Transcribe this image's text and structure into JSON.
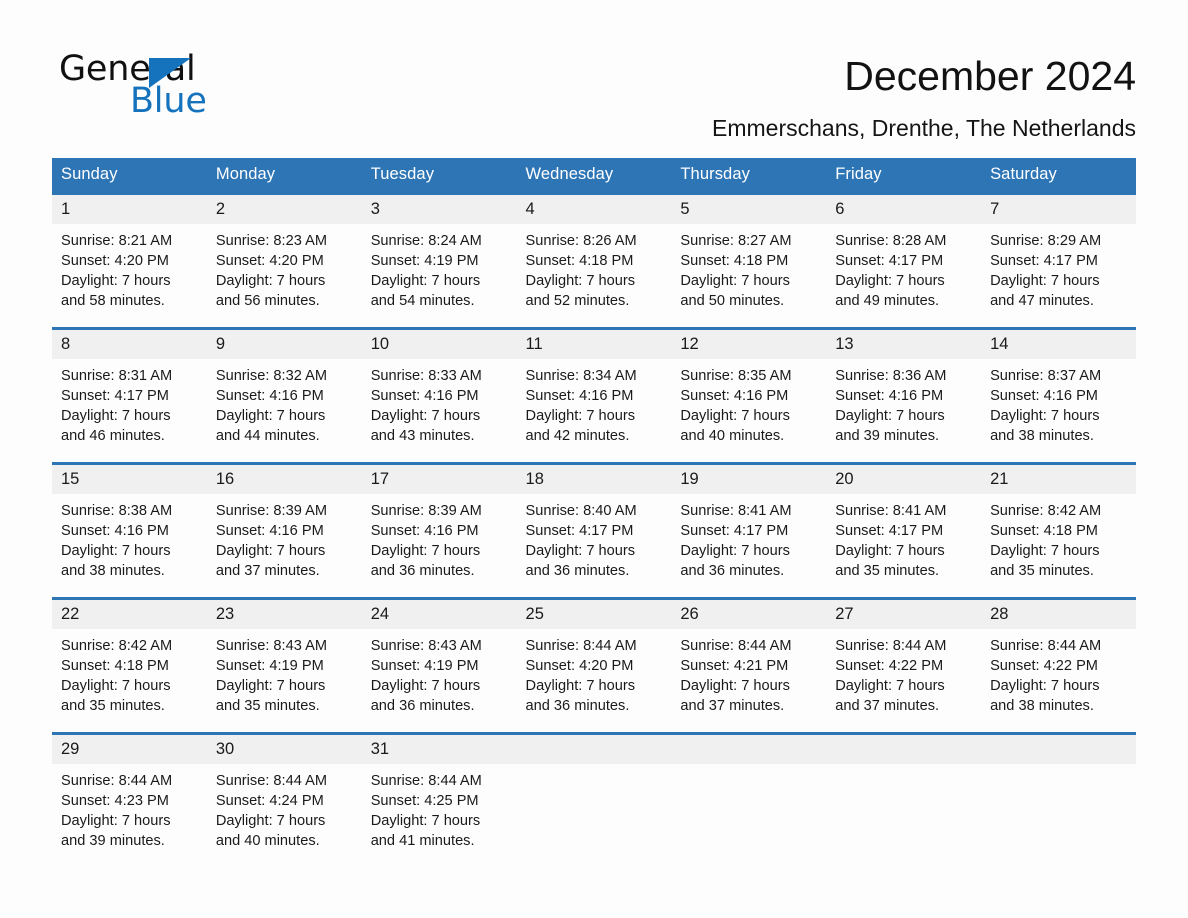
{
  "brand": {
    "name_part1": "General",
    "name_part2": "Blue",
    "accent_color": "#1573bd"
  },
  "header": {
    "title": "December 2024",
    "subtitle": "Emmerschans, Drenthe, The Netherlands",
    "header_band_color": "#2e75b6",
    "day_band_color": "#f0f0f0"
  },
  "calendar": {
    "weekday_headers": [
      "Sunday",
      "Monday",
      "Tuesday",
      "Wednesday",
      "Thursday",
      "Friday",
      "Saturday"
    ],
    "weeks": [
      [
        {
          "day": "1",
          "sunrise": "Sunrise: 8:21 AM",
          "sunset": "Sunset: 4:20 PM",
          "daylight_line1": "Daylight: 7 hours",
          "daylight_line2": "and 58 minutes."
        },
        {
          "day": "2",
          "sunrise": "Sunrise: 8:23 AM",
          "sunset": "Sunset: 4:20 PM",
          "daylight_line1": "Daylight: 7 hours",
          "daylight_line2": "and 56 minutes."
        },
        {
          "day": "3",
          "sunrise": "Sunrise: 8:24 AM",
          "sunset": "Sunset: 4:19 PM",
          "daylight_line1": "Daylight: 7 hours",
          "daylight_line2": "and 54 minutes."
        },
        {
          "day": "4",
          "sunrise": "Sunrise: 8:26 AM",
          "sunset": "Sunset: 4:18 PM",
          "daylight_line1": "Daylight: 7 hours",
          "daylight_line2": "and 52 minutes."
        },
        {
          "day": "5",
          "sunrise": "Sunrise: 8:27 AM",
          "sunset": "Sunset: 4:18 PM",
          "daylight_line1": "Daylight: 7 hours",
          "daylight_line2": "and 50 minutes."
        },
        {
          "day": "6",
          "sunrise": "Sunrise: 8:28 AM",
          "sunset": "Sunset: 4:17 PM",
          "daylight_line1": "Daylight: 7 hours",
          "daylight_line2": "and 49 minutes."
        },
        {
          "day": "7",
          "sunrise": "Sunrise: 8:29 AM",
          "sunset": "Sunset: 4:17 PM",
          "daylight_line1": "Daylight: 7 hours",
          "daylight_line2": "and 47 minutes."
        }
      ],
      [
        {
          "day": "8",
          "sunrise": "Sunrise: 8:31 AM",
          "sunset": "Sunset: 4:17 PM",
          "daylight_line1": "Daylight: 7 hours",
          "daylight_line2": "and 46 minutes."
        },
        {
          "day": "9",
          "sunrise": "Sunrise: 8:32 AM",
          "sunset": "Sunset: 4:16 PM",
          "daylight_line1": "Daylight: 7 hours",
          "daylight_line2": "and 44 minutes."
        },
        {
          "day": "10",
          "sunrise": "Sunrise: 8:33 AM",
          "sunset": "Sunset: 4:16 PM",
          "daylight_line1": "Daylight: 7 hours",
          "daylight_line2": "and 43 minutes."
        },
        {
          "day": "11",
          "sunrise": "Sunrise: 8:34 AM",
          "sunset": "Sunset: 4:16 PM",
          "daylight_line1": "Daylight: 7 hours",
          "daylight_line2": "and 42 minutes."
        },
        {
          "day": "12",
          "sunrise": "Sunrise: 8:35 AM",
          "sunset": "Sunset: 4:16 PM",
          "daylight_line1": "Daylight: 7 hours",
          "daylight_line2": "and 40 minutes."
        },
        {
          "day": "13",
          "sunrise": "Sunrise: 8:36 AM",
          "sunset": "Sunset: 4:16 PM",
          "daylight_line1": "Daylight: 7 hours",
          "daylight_line2": "and 39 minutes."
        },
        {
          "day": "14",
          "sunrise": "Sunrise: 8:37 AM",
          "sunset": "Sunset: 4:16 PM",
          "daylight_line1": "Daylight: 7 hours",
          "daylight_line2": "and 38 minutes."
        }
      ],
      [
        {
          "day": "15",
          "sunrise": "Sunrise: 8:38 AM",
          "sunset": "Sunset: 4:16 PM",
          "daylight_line1": "Daylight: 7 hours",
          "daylight_line2": "and 38 minutes."
        },
        {
          "day": "16",
          "sunrise": "Sunrise: 8:39 AM",
          "sunset": "Sunset: 4:16 PM",
          "daylight_line1": "Daylight: 7 hours",
          "daylight_line2": "and 37 minutes."
        },
        {
          "day": "17",
          "sunrise": "Sunrise: 8:39 AM",
          "sunset": "Sunset: 4:16 PM",
          "daylight_line1": "Daylight: 7 hours",
          "daylight_line2": "and 36 minutes."
        },
        {
          "day": "18",
          "sunrise": "Sunrise: 8:40 AM",
          "sunset": "Sunset: 4:17 PM",
          "daylight_line1": "Daylight: 7 hours",
          "daylight_line2": "and 36 minutes."
        },
        {
          "day": "19",
          "sunrise": "Sunrise: 8:41 AM",
          "sunset": "Sunset: 4:17 PM",
          "daylight_line1": "Daylight: 7 hours",
          "daylight_line2": "and 36 minutes."
        },
        {
          "day": "20",
          "sunrise": "Sunrise: 8:41 AM",
          "sunset": "Sunset: 4:17 PM",
          "daylight_line1": "Daylight: 7 hours",
          "daylight_line2": "and 35 minutes."
        },
        {
          "day": "21",
          "sunrise": "Sunrise: 8:42 AM",
          "sunset": "Sunset: 4:18 PM",
          "daylight_line1": "Daylight: 7 hours",
          "daylight_line2": "and 35 minutes."
        }
      ],
      [
        {
          "day": "22",
          "sunrise": "Sunrise: 8:42 AM",
          "sunset": "Sunset: 4:18 PM",
          "daylight_line1": "Daylight: 7 hours",
          "daylight_line2": "and 35 minutes."
        },
        {
          "day": "23",
          "sunrise": "Sunrise: 8:43 AM",
          "sunset": "Sunset: 4:19 PM",
          "daylight_line1": "Daylight: 7 hours",
          "daylight_line2": "and 35 minutes."
        },
        {
          "day": "24",
          "sunrise": "Sunrise: 8:43 AM",
          "sunset": "Sunset: 4:19 PM",
          "daylight_line1": "Daylight: 7 hours",
          "daylight_line2": "and 36 minutes."
        },
        {
          "day": "25",
          "sunrise": "Sunrise: 8:44 AM",
          "sunset": "Sunset: 4:20 PM",
          "daylight_line1": "Daylight: 7 hours",
          "daylight_line2": "and 36 minutes."
        },
        {
          "day": "26",
          "sunrise": "Sunrise: 8:44 AM",
          "sunset": "Sunset: 4:21 PM",
          "daylight_line1": "Daylight: 7 hours",
          "daylight_line2": "and 37 minutes."
        },
        {
          "day": "27",
          "sunrise": "Sunrise: 8:44 AM",
          "sunset": "Sunset: 4:22 PM",
          "daylight_line1": "Daylight: 7 hours",
          "daylight_line2": "and 37 minutes."
        },
        {
          "day": "28",
          "sunrise": "Sunrise: 8:44 AM",
          "sunset": "Sunset: 4:22 PM",
          "daylight_line1": "Daylight: 7 hours",
          "daylight_line2": "and 38 minutes."
        }
      ],
      [
        {
          "day": "29",
          "sunrise": "Sunrise: 8:44 AM",
          "sunset": "Sunset: 4:23 PM",
          "daylight_line1": "Daylight: 7 hours",
          "daylight_line2": "and 39 minutes."
        },
        {
          "day": "30",
          "sunrise": "Sunrise: 8:44 AM",
          "sunset": "Sunset: 4:24 PM",
          "daylight_line1": "Daylight: 7 hours",
          "daylight_line2": "and 40 minutes."
        },
        {
          "day": "31",
          "sunrise": "Sunrise: 8:44 AM",
          "sunset": "Sunset: 4:25 PM",
          "daylight_line1": "Daylight: 7 hours",
          "daylight_line2": "and 41 minutes."
        },
        {
          "day": "",
          "sunrise": "",
          "sunset": "",
          "daylight_line1": "",
          "daylight_line2": ""
        },
        {
          "day": "",
          "sunrise": "",
          "sunset": "",
          "daylight_line1": "",
          "daylight_line2": ""
        },
        {
          "day": "",
          "sunrise": "",
          "sunset": "",
          "daylight_line1": "",
          "daylight_line2": ""
        },
        {
          "day": "",
          "sunrise": "",
          "sunset": "",
          "daylight_line1": "",
          "daylight_line2": ""
        }
      ]
    ]
  }
}
